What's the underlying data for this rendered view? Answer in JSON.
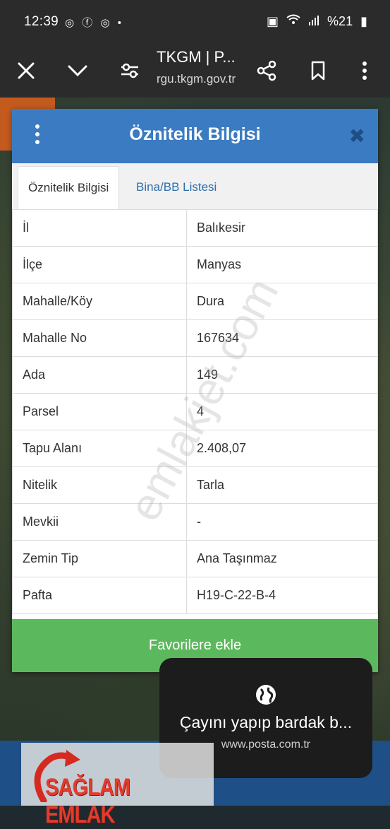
{
  "status_bar": {
    "time": "12:39",
    "notif_icons": [
      "chrome-icon",
      "facebook-icon",
      "chrome-icon",
      "dot"
    ],
    "battery_text": "%21"
  },
  "toolbar": {
    "title": "TKGM | P...",
    "url": "rgu.tkgm.gov.tr"
  },
  "panel": {
    "title": "Öznitelik Bilgisi",
    "tabs": [
      {
        "label": "Öznitelik Bilgisi",
        "active": true
      },
      {
        "label": "Bina/BB Listesi",
        "active": false
      }
    ],
    "rows": [
      {
        "key": "İl",
        "value": "Balıkesir"
      },
      {
        "key": "İlçe",
        "value": "Manyas"
      },
      {
        "key": "Mahalle/Köy",
        "value": "Dura"
      },
      {
        "key": "Mahalle No",
        "value": "167634"
      },
      {
        "key": "Ada",
        "value": "149"
      },
      {
        "key": "Parsel",
        "value": "4"
      },
      {
        "key": "Tapu Alanı",
        "value": "2.408,07"
      },
      {
        "key": "Nitelik",
        "value": "Tarla"
      },
      {
        "key": "Mevkii",
        "value": "-"
      },
      {
        "key": "Zemin Tip",
        "value": "Ana Taşınmaz"
      },
      {
        "key": "Pafta",
        "value": "H19-C-22-B-4"
      }
    ],
    "favorite_button": "Favorilere ekle"
  },
  "watermark": "emlakjet.com",
  "toast": {
    "text": "Çayını yapıp bardak b...",
    "url": "www.posta.com.tr"
  },
  "logo": {
    "text": "SAĞLAM EMLAK"
  },
  "colors": {
    "header_blue": "#3b7bc1",
    "button_green": "#5cb85c",
    "link_blue": "#2f6fab",
    "logo_red": "#e33b2e"
  }
}
